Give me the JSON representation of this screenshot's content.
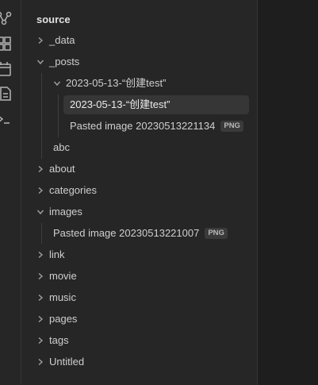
{
  "ribbon": {
    "icons": [
      "graph-icon",
      "grid-icon",
      "calendar-icon",
      "files-icon",
      "terminal-icon"
    ]
  },
  "explorer": {
    "root_label": "source",
    "items": [
      {
        "label": "_data",
        "type": "folder",
        "state": "collapsed"
      },
      {
        "label": "_posts",
        "type": "folder",
        "state": "expanded"
      },
      {
        "label": "2023-05-13-“创建test”",
        "type": "folder",
        "state": "expanded"
      },
      {
        "label": "2023-05-13-“创建test”",
        "type": "file",
        "selected": true
      },
      {
        "label": "Pasted image 20230513221134",
        "type": "file",
        "badge": "PNG"
      },
      {
        "label": "abc",
        "type": "file"
      },
      {
        "label": "about",
        "type": "folder",
        "state": "collapsed"
      },
      {
        "label": "categories",
        "type": "folder",
        "state": "collapsed"
      },
      {
        "label": "images",
        "type": "folder",
        "state": "expanded"
      },
      {
        "label": "Pasted image 20230513221007",
        "type": "file",
        "badge": "PNG"
      },
      {
        "label": "link",
        "type": "folder",
        "state": "collapsed"
      },
      {
        "label": "movie",
        "type": "folder",
        "state": "collapsed"
      },
      {
        "label": "music",
        "type": "folder",
        "state": "collapsed"
      },
      {
        "label": "pages",
        "type": "folder",
        "state": "collapsed"
      },
      {
        "label": "tags",
        "type": "folder",
        "state": "collapsed"
      },
      {
        "label": "Untitled",
        "type": "folder",
        "state": "collapsed"
      }
    ]
  },
  "colors": {
    "background": "#262626",
    "right_pane": "#1e1e1e",
    "selected_row": "#363636",
    "text": "#cfcfcf"
  }
}
